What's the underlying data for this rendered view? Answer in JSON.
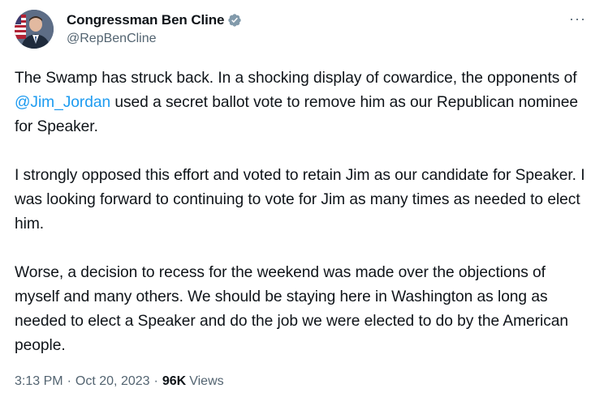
{
  "author": {
    "display_name": "Congressman Ben Cline",
    "handle": "@RepBenCline",
    "verified": true,
    "verified_color": "#829aab",
    "avatar_icon": "profile-photo-with-flag"
  },
  "menu_icon": "more-dots-icon",
  "tweet": {
    "p1_before": "The Swamp has struck back. In a shocking display of cowardice, the opponents of ",
    "p1_mention": "@Jim_Jordan",
    "p1_after": " used a secret ballot vote to remove him as our Republican nominee for Speaker.",
    "p2": "I strongly opposed this effort and voted to retain Jim as our candidate for Speaker. I was looking forward to continuing to vote for Jim as many times as needed to elect him.",
    "p3": "Worse, a decision to recess for the weekend was made over the objections of myself and many others. We should be staying here in Washington as long as needed to elect a Speaker and do the job we were elected to do by the American people."
  },
  "meta": {
    "time": "3:13 PM",
    "dot1": "·",
    "date": "Oct 20, 2023",
    "dot2": "·",
    "views_count": "96K",
    "views_label": "Views"
  },
  "colors": {
    "mention": "#1d9bf0",
    "secondary_text": "#536471",
    "primary_text": "#0f1419"
  }
}
